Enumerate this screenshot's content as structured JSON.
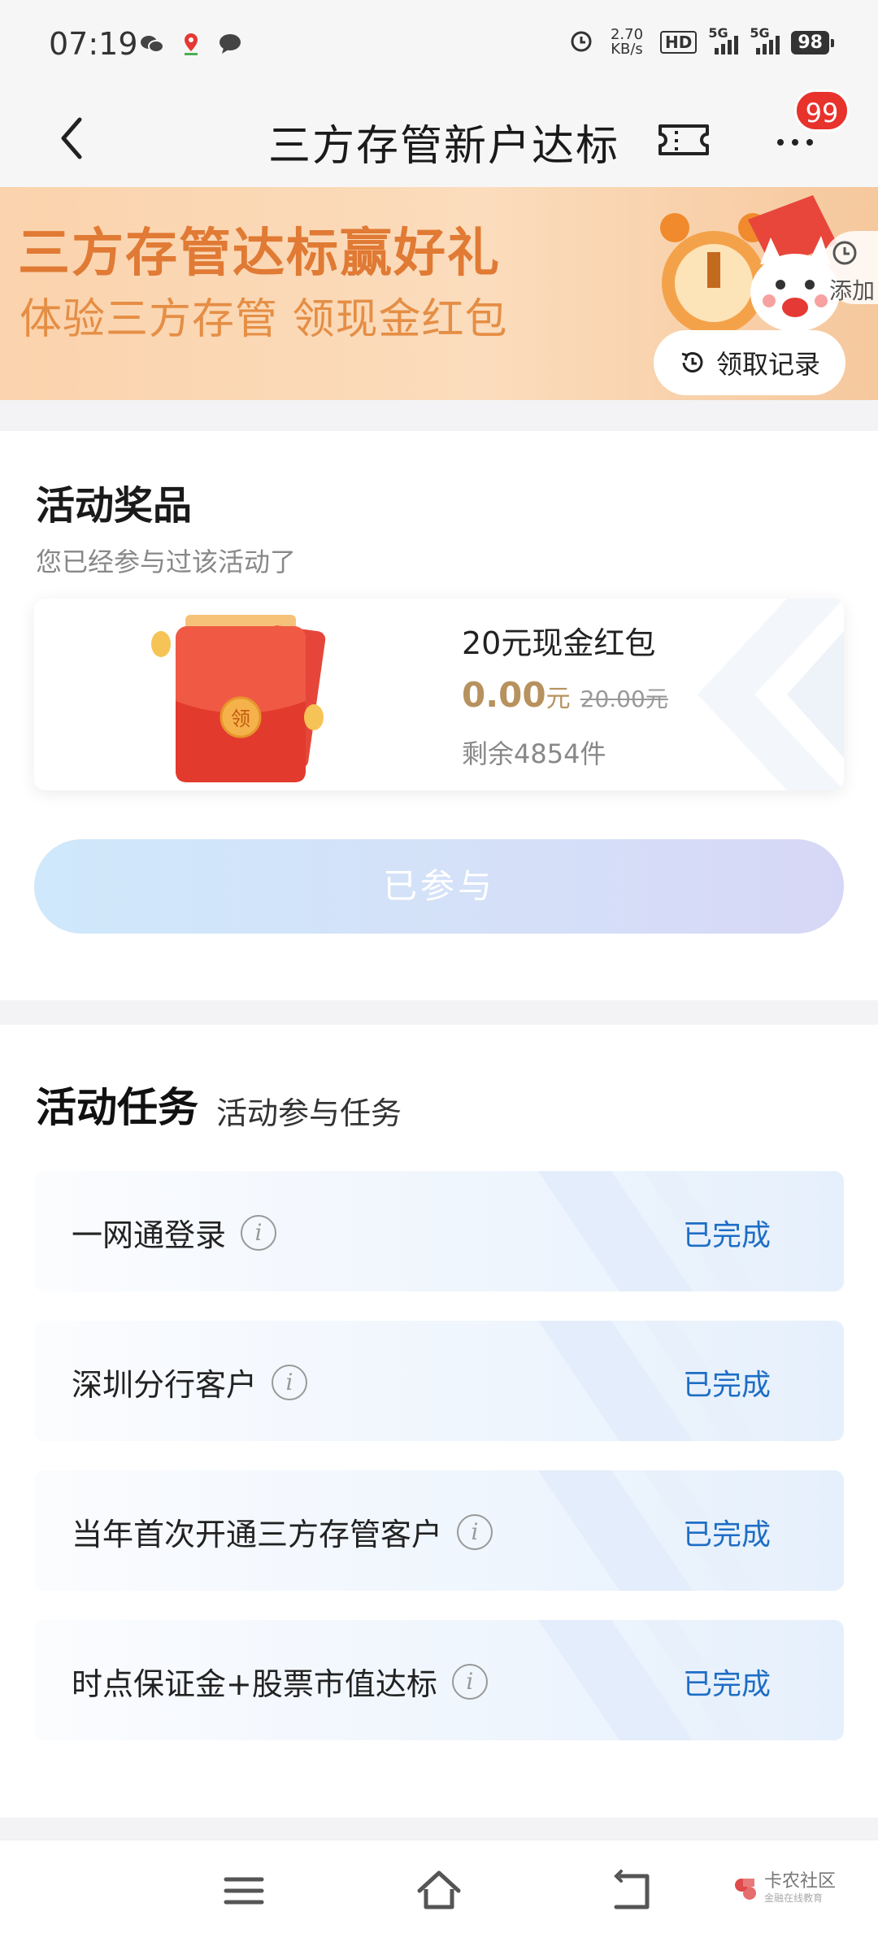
{
  "status_bar": {
    "time": "07:19",
    "net_speed_value": "2.70",
    "net_speed_unit": "KB/s",
    "hd_label": "HD",
    "signal1_label": "5G",
    "signal2_label": "5G",
    "battery": "98"
  },
  "nav": {
    "title": "三方存管新户达标",
    "badge": "99"
  },
  "banner": {
    "title": "三方存管达标赢好礼",
    "subtitle": "体验三方存管 领现金红包",
    "add_label": "添加",
    "record_label": "领取记录"
  },
  "prize": {
    "heading": "活动奖品",
    "note": "您已经参与过该活动了",
    "name": "20元现金红包",
    "price_now": "0.00",
    "price_unit": "元",
    "price_orig": "20.00元",
    "stock": "剩余4854件",
    "envelope_char": "领",
    "button_label": "已参与"
  },
  "tasks": {
    "heading": "活动任务",
    "subheading": "活动参与任务",
    "items": [
      {
        "label": "一网通登录",
        "status": "已完成"
      },
      {
        "label": "深圳分行客户",
        "status": "已完成"
      },
      {
        "label": "当年首次开通三方存管客户",
        "status": "已完成"
      },
      {
        "label": "时点保证金+股票市值达标",
        "status": "已完成"
      }
    ]
  },
  "watermark": {
    "title": "卡农社区",
    "subtitle": "金融在线教育"
  },
  "colors": {
    "accent_orange": "#e07a34",
    "price_gold": "#b7925e",
    "status_blue": "#1e6ec4",
    "badge_red": "#e8322c"
  }
}
